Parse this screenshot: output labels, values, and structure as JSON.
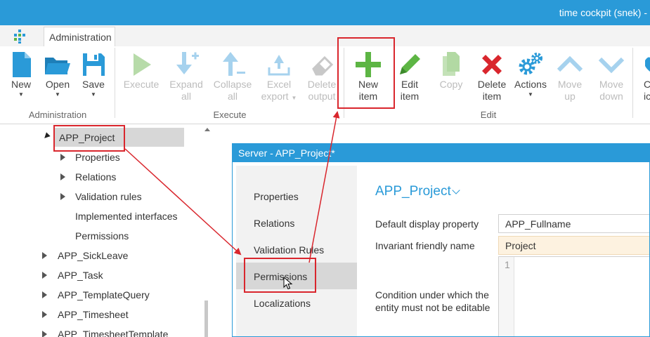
{
  "window": {
    "title": "time cockpit (snek) -"
  },
  "tabs": {
    "administration": "Administration"
  },
  "ribbon": {
    "groups": {
      "administration": "Administration",
      "execute": "Execute",
      "edit": "Edit"
    },
    "new": "New",
    "open": "Open",
    "save": "Save",
    "execute": "Execute",
    "expand_1": "Expand",
    "expand_2": "all",
    "collapse_1": "Collapse",
    "collapse_2": "all",
    "excel_1": "Excel",
    "excel_2": "export",
    "delete_output_1": "Delete",
    "delete_output_2": "output",
    "new_item_1": "New",
    "new_item_2": "item",
    "edit_item_1": "Edit",
    "edit_item_2": "item",
    "copy": "Copy",
    "delete_item_1": "Delete",
    "delete_item_2": "item",
    "actions": "Actions",
    "move_up_1": "Move",
    "move_up_2": "up",
    "move_down_1": "Move",
    "move_down_2": "down",
    "cut_1": "C",
    "cut_2": "ic"
  },
  "tree": {
    "selected": "APP_Project",
    "children": [
      "Properties",
      "Relations",
      "Validation rules",
      "Implemented interfaces",
      "Permissions"
    ],
    "siblings": [
      "APP_SickLeave",
      "APP_Task",
      "APP_TemplateQuery",
      "APP_Timesheet",
      "APP_TimesheetTemplate"
    ]
  },
  "dialog": {
    "title": "Server - APP_Project*",
    "nav": [
      "Properties",
      "Relations",
      "Validation Rules",
      "Permissions",
      "Localizations"
    ],
    "entity_title": "APP_Project",
    "fields": {
      "display_property_label": "Default display property",
      "display_property_value": "APP_Fullname",
      "friendly_name_label": "Invariant friendly name",
      "friendly_name_value": "Project",
      "condition_label_1": "Condition under which the",
      "condition_label_2": "entity must not be editable",
      "line_number": "1"
    }
  },
  "colors": {
    "accent": "#2a9ad8",
    "highlight": "#d9262d",
    "add_green": "#5db544",
    "delete_red": "#d9262d"
  }
}
